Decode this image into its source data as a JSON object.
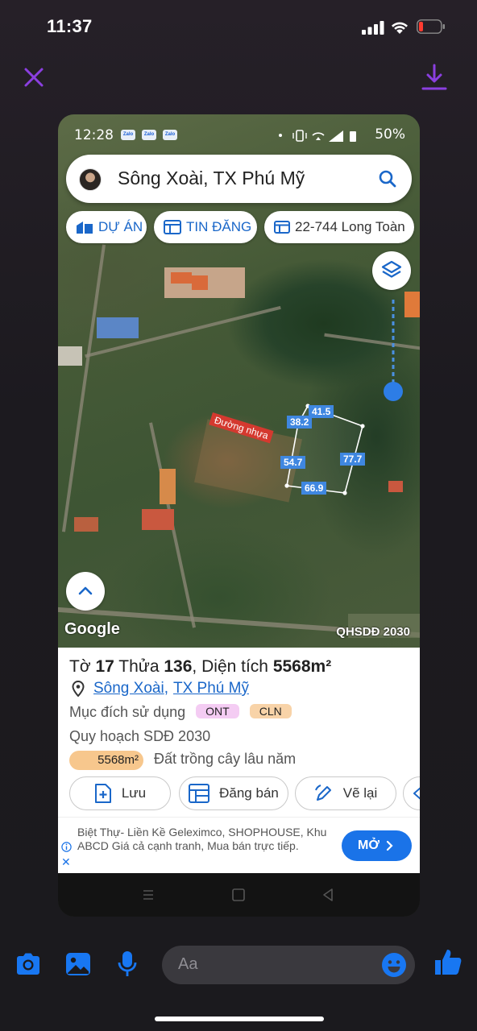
{
  "ios_status": {
    "time": "11:37"
  },
  "phone_screenshot": {
    "status_bar": {
      "time": "12:28",
      "zalo_label": "Zalo",
      "battery": "50%"
    },
    "search": {
      "text": "Sông Xoài, TX Phú Mỹ"
    },
    "chips": [
      {
        "label": "DỰ ÁN"
      },
      {
        "label": "TIN ĐĂNG"
      },
      {
        "label": "22-744 Long Toàn"
      }
    ],
    "map": {
      "road_label": "Đường nhựa",
      "dimensions": [
        "41.5",
        "38.2",
        "54.7",
        "77.7",
        "66.9"
      ],
      "google": "Google",
      "layer_label": "QHSDĐ 2030"
    },
    "parcel": {
      "title_prefix": "Tờ",
      "sheet_no": "17",
      "parcel_word": "Thửa",
      "parcel_no": "136",
      "area_label": "Diện tích",
      "area_value": "5568m²",
      "commune": "Sông Xoài",
      "town": "TX Phú Mỹ",
      "purpose_label": "Mục đích sử dụng",
      "purpose_tags": [
        "ONT",
        "CLN"
      ],
      "planning_label": "Quy hoạch SDĐ 2030",
      "planning_area": "5568m²",
      "planning_use": "Đất trồng cây lâu năm"
    },
    "actions": {
      "save": "Lưu",
      "post": "Đăng bán",
      "redraw": "Vẽ lại"
    },
    "ad": {
      "text": "Biệt Thự- Liền Kề Geleximco, SHOPHOUSE, Khu ABCD Giá cả cạnh tranh, Mua bán trực tiếp.",
      "button": "MỞ"
    }
  },
  "composer": {
    "placeholder": "Aa"
  },
  "colors": {
    "accent": "#8b3fe0",
    "messenger_blue": "#1877f2",
    "map_blue": "#1a67c9"
  }
}
